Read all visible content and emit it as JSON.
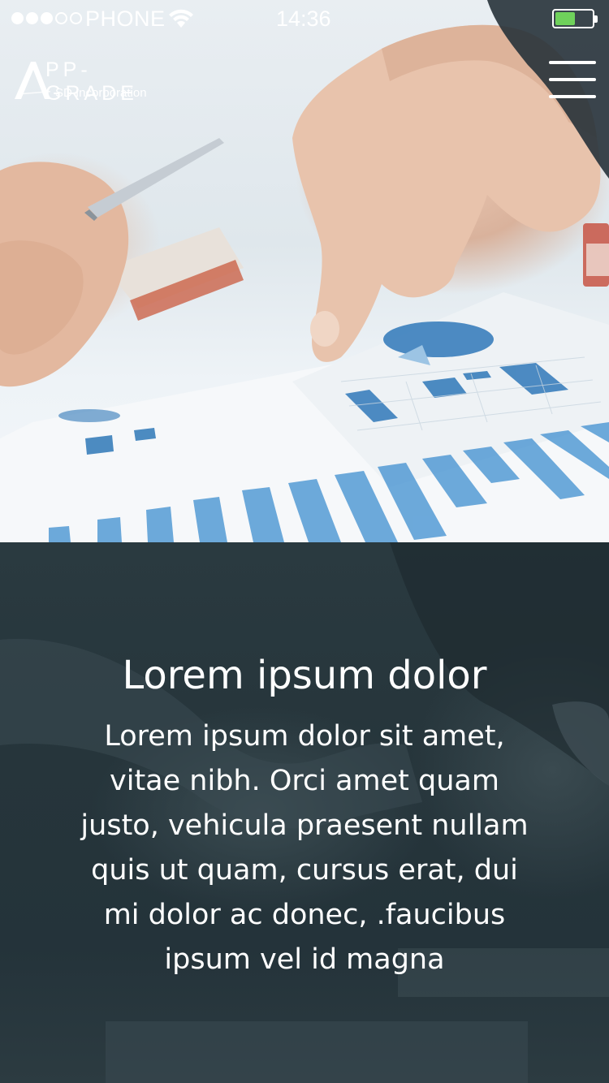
{
  "status_bar": {
    "carrier": "PHONE",
    "time": "14:36",
    "signal_bars_filled": 3,
    "signal_bars_total": 5,
    "battery_level": 0.55,
    "battery_color": "#6fd15b"
  },
  "logo": {
    "main": "PP-GRADE",
    "sub": "SD Incorporation"
  },
  "menu": {
    "icon": "hamburger-menu-icon"
  },
  "content": {
    "title": "Lorem ipsum dolor",
    "body": "Lorem ipsum dolor sit amet, vitae nibh. Orci amet quam justo, vehicula praesent nullam quis ut quam, cursus erat, dui mi dolor ac donec, .faucibus ipsum vel id magna"
  },
  "colors": {
    "text": "#ffffff",
    "content_background": "#26353b"
  }
}
